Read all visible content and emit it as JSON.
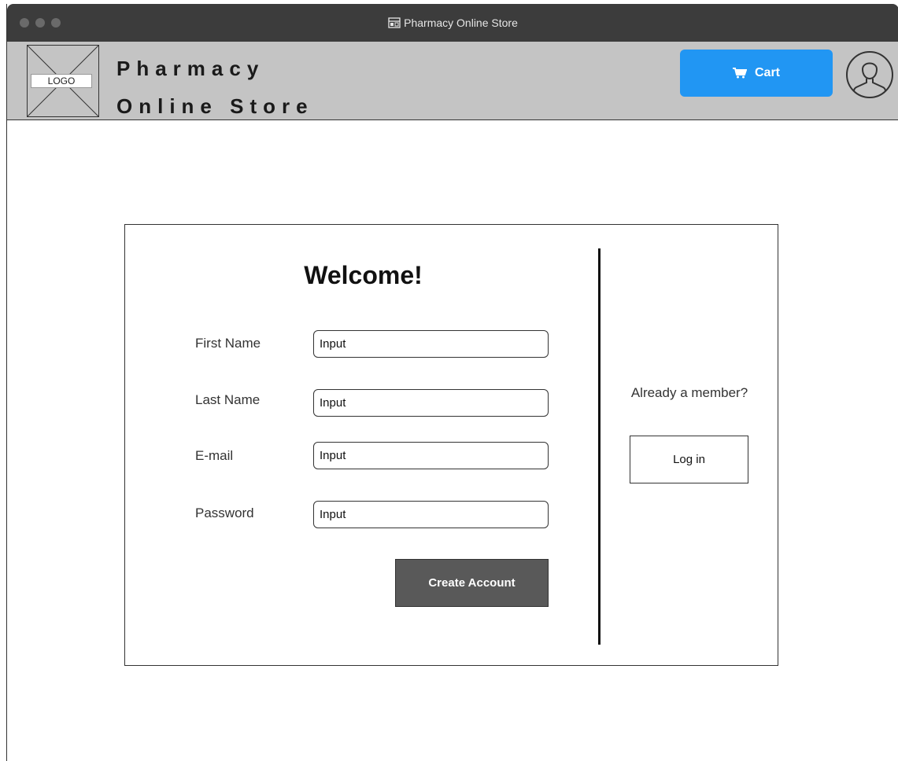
{
  "window": {
    "title": "Pharmacy Online Store"
  },
  "header": {
    "logo_label": "LOGO",
    "brand_line1": "Pharmacy",
    "brand_line2": "Online Store",
    "cart_label": "Cart"
  },
  "signup": {
    "heading": "Welcome!",
    "fields": [
      {
        "label": "First Name",
        "value": "Input"
      },
      {
        "label": "Last Name",
        "value": "Input"
      },
      {
        "label": "E-mail",
        "value": "Input"
      },
      {
        "label": "Password",
        "value": "Input"
      }
    ],
    "submit_label": "Create Account"
  },
  "login": {
    "prompt": "Already a member?",
    "button_label": "Log in"
  },
  "colors": {
    "titlebar": "#3c3c3c",
    "header_bg": "#c4c4c4",
    "accent": "#2196f3",
    "submit_bg": "#595959"
  },
  "icons": [
    "window-app-icon",
    "cart-icon",
    "user-avatar-icon",
    "logo-placeholder-icon"
  ]
}
